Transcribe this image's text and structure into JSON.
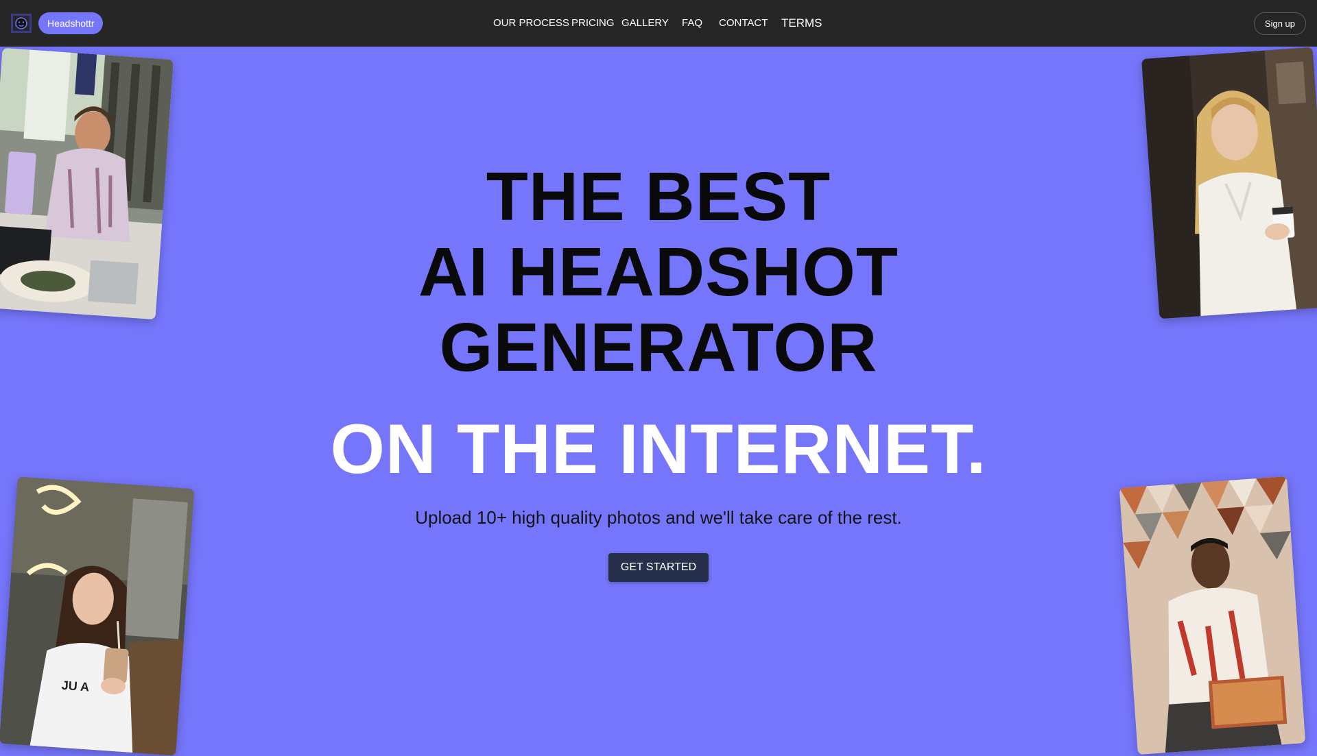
{
  "header": {
    "logo_icon": "bracket-face-icon",
    "brand_label": "Headshottr",
    "nav": [
      {
        "label": "OUR PROCESS"
      },
      {
        "label": "PRICING"
      },
      {
        "label": "GALLERY"
      },
      {
        "label": "FAQ"
      },
      {
        "label": "CONTACT"
      },
      {
        "label": "TERMS"
      }
    ],
    "signup_label": "Sign up"
  },
  "hero": {
    "line1": "THE BEST",
    "line2": "AI HEADSHOT",
    "line3": "GENERATOR",
    "line4": "ON THE INTERNET.",
    "subtitle": "Upload 10+ high quality photos and we'll take care of the rest.",
    "cta_label": "GET STARTED"
  },
  "photo_shirt_text": "JU   A",
  "colors": {
    "background": "#7676fc",
    "topbar": "#262626",
    "accent": "#7676fc",
    "cta": "#26304a"
  }
}
